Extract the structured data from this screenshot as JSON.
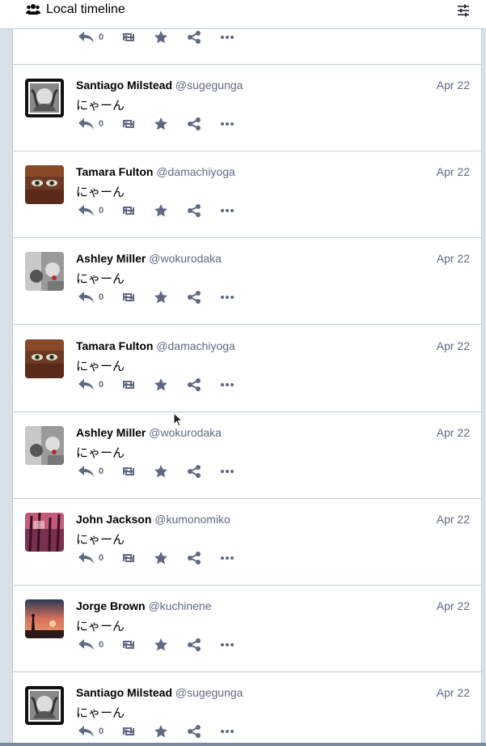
{
  "header": {
    "title": "Local timeline",
    "icon": "users-icon",
    "settings_icon": "sliders-icon"
  },
  "first_status": {
    "reply_count": "0"
  },
  "statuses": [
    {
      "display_name": "Santiago Milstead",
      "acct": "@sugegunga",
      "time": "Apr 22",
      "content": "にゃーん",
      "reply_count": "0",
      "avatar": "angel-bw"
    },
    {
      "display_name": "Tamara Fulton",
      "acct": "@damachiyoga",
      "time": "Apr 22",
      "content": "にゃーん",
      "reply_count": "0",
      "avatar": "eyes-veil"
    },
    {
      "display_name": "Ashley Miller",
      "acct": "@wokurodaka",
      "time": "Apr 22",
      "content": "にゃーん",
      "reply_count": "0",
      "avatar": "gray-red"
    },
    {
      "display_name": "Tamara Fulton",
      "acct": "@damachiyoga",
      "time": "Apr 22",
      "content": "にゃーん",
      "reply_count": "0",
      "avatar": "eyes-veil"
    },
    {
      "display_name": "Ashley Miller",
      "acct": "@wokurodaka",
      "time": "Apr 22",
      "content": "にゃーん",
      "reply_count": "0",
      "avatar": "gray-red"
    },
    {
      "display_name": "John Jackson",
      "acct": "@kumonomiko",
      "time": "Apr 22",
      "content": "にゃーん",
      "reply_count": "0",
      "avatar": "forest-pink"
    },
    {
      "display_name": "Jorge Brown",
      "acct": "@kuchinene",
      "time": "Apr 22",
      "content": "にゃーん",
      "reply_count": "0",
      "avatar": "sunset"
    },
    {
      "display_name": "Santiago Milstead",
      "acct": "@sugegunga",
      "time": "Apr 22",
      "content": "にゃーん",
      "reply_count": "0",
      "avatar": "angel-bw"
    }
  ]
}
